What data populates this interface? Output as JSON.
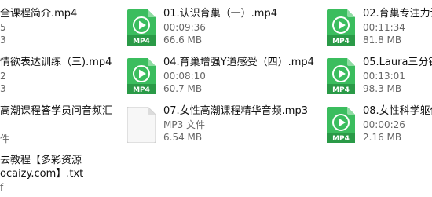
{
  "files": [
    {
      "name": "全课程简介.mp4",
      "meta1": "5",
      "meta2": "3",
      "icon": "mp4-file-icon"
    },
    {
      "name": "01.认识育巢（一）.mp4",
      "meta1": "00:09:36",
      "meta2": "66.6 MB",
      "icon": "mp4-file-icon"
    },
    {
      "name": "02.育巢专注力训",
      "meta1": "00:11:34",
      "meta2": "81.8 MB",
      "icon": "mp4-file-icon"
    },
    {
      "name": "情欲表达训练（三).mp4",
      "meta1": "2",
      "meta2": "3",
      "icon": "mp4-file-icon"
    },
    {
      "name": "04.育巢增强Y道感受（四）.mp4",
      "meta1": "00:08:10",
      "meta2": "60.7 MB",
      "icon": "mp4-file-icon"
    },
    {
      "name": "05.Laura三分钟",
      "meta1": "00:13:01",
      "meta2": "98.3 MB",
      "icon": "mp4-file-icon"
    },
    {
      "name": "高潮课程答学员问音频汇",
      "meta1": "件",
      "meta2": "",
      "icon": "document-file-icon"
    },
    {
      "name": "07.女性高潮课程精华音频.mp3",
      "meta1": "MP3 文件",
      "meta2": "6.54 MB",
      "icon": "mp3-file-icon"
    },
    {
      "name": "08.女性科学躯体",
      "meta1": "00:00:26",
      "meta2": "2.16 MB",
      "icon": "mp4-file-icon"
    },
    {
      "name1": "去教程【多彩资源",
      "name2": "ocaizy.com】.txt",
      "meta1": "f",
      "icon": "txt-file-icon"
    }
  ],
  "badge": "MP4",
  "colors": {
    "mp4_green": "#3bbd5e",
    "mp4_green_dark": "#2a9a47",
    "name_text": "#111111",
    "meta_text": "#666666"
  }
}
